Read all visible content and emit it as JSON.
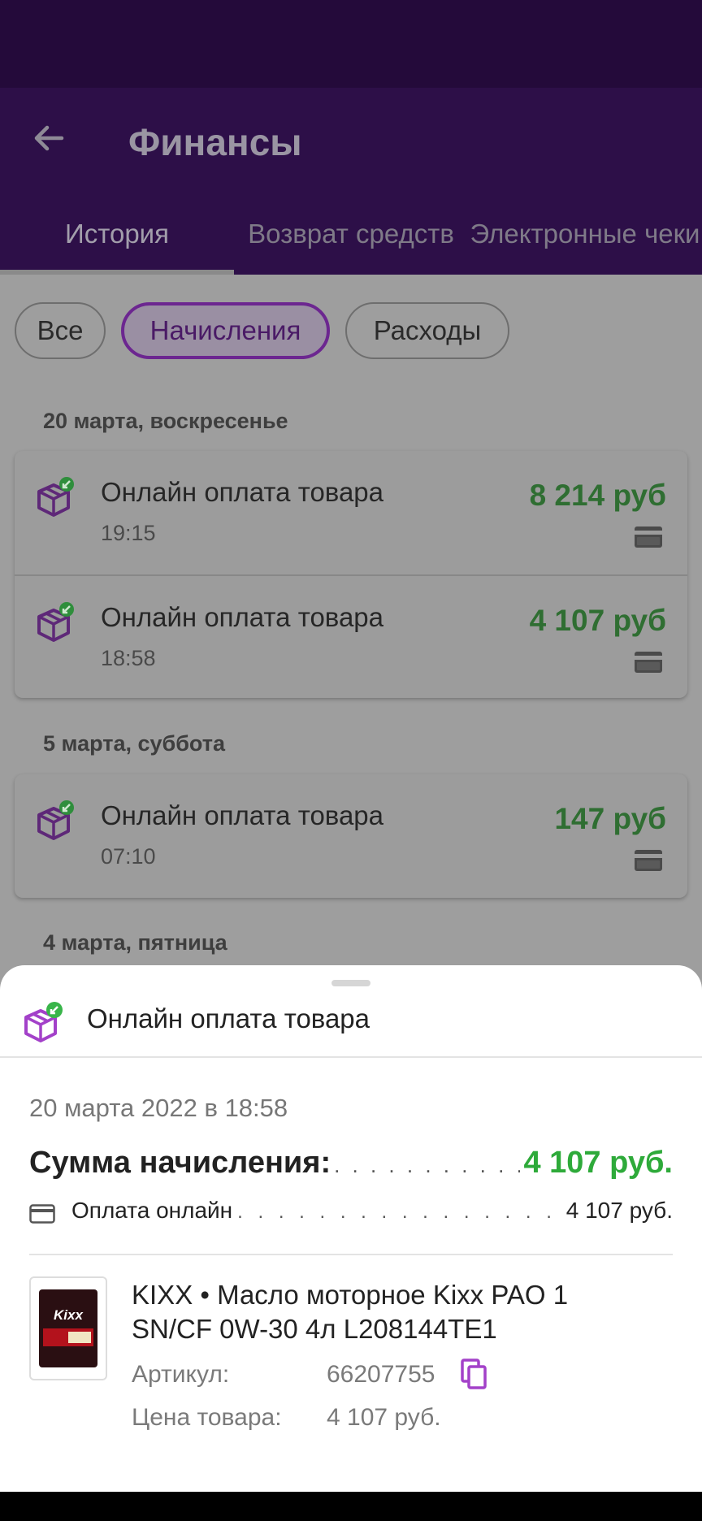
{
  "appbar": {
    "title": "Финансы"
  },
  "tabs": [
    {
      "label": "История",
      "active": true
    },
    {
      "label": "Возврат средств",
      "active": false
    },
    {
      "label": "Электронные чеки",
      "active": false
    }
  ],
  "chips": [
    {
      "label": "Все",
      "active": false
    },
    {
      "label": "Начисления",
      "active": true
    },
    {
      "label": "Расходы",
      "active": false
    }
  ],
  "groups": [
    {
      "date": "20 марта, воскресенье",
      "items": [
        {
          "title": "Онлайн оплата товара",
          "time": "19:15",
          "amount": "8 214 руб"
        },
        {
          "title": "Онлайн оплата товара",
          "time": "18:58",
          "amount": "4 107 руб"
        }
      ]
    },
    {
      "date": "5 марта, суббота",
      "items": [
        {
          "title": "Онлайн оплата товара",
          "time": "07:10",
          "amount": "147 руб"
        }
      ]
    },
    {
      "date": "4 марта, пятница",
      "items": []
    }
  ],
  "sheet": {
    "title": "Онлайн оплата товара",
    "datetime": "20 марта 2022 в 18:58",
    "sum_label": "Сумма начисления:",
    "sum_value": "4 107 руб.",
    "payment_label": "Оплата онлайн",
    "payment_value": "4 107 руб.",
    "product": {
      "pack_brand": "Kixx",
      "title": "KIXX • Масло моторное Kixx PAO 1 SN/CF 0W-30 4л L208144TE1",
      "article_label": "Артикул:",
      "article_value": "66207755",
      "price_label": "Цена товара:",
      "price_value": "4 107 руб."
    }
  },
  "colors": {
    "accent": "#7b2d9e",
    "amount_green": "#2eaa3a",
    "appbar": "#2d0f48",
    "statusbar": "#240a3a"
  },
  "icons": {
    "back": "arrow-left-icon",
    "transaction": "package-incoming-icon",
    "payment": "credit-card-icon",
    "copy": "copy-icon"
  }
}
